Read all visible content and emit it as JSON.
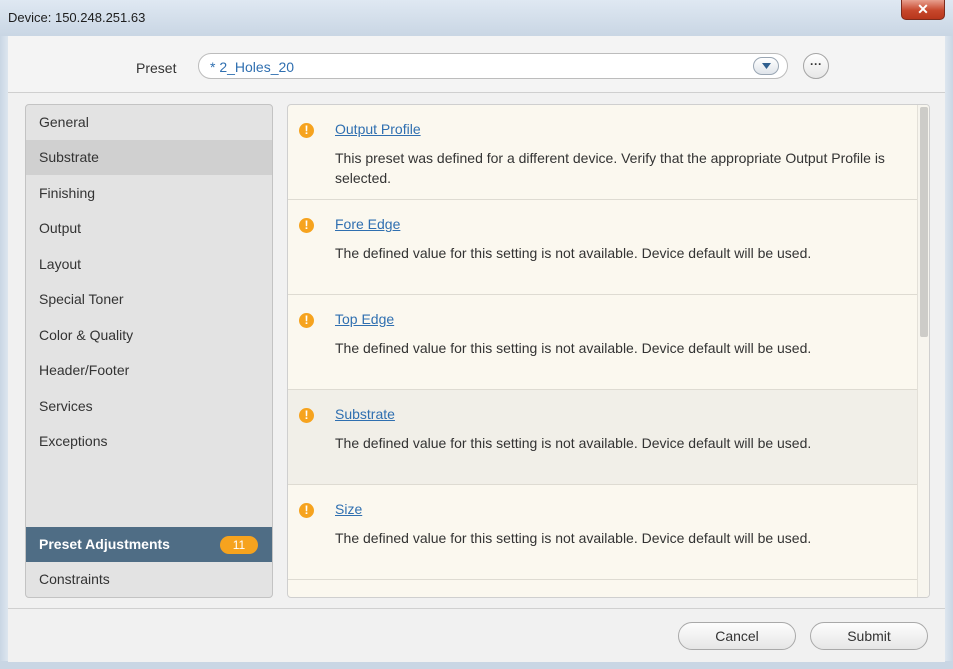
{
  "window": {
    "title": "Device: 150.248.251.63",
    "close_glyph": "✕"
  },
  "preset": {
    "label": "Preset",
    "value": "* 2_Holes_20",
    "more_glyph": "···"
  },
  "sidebar": {
    "items": [
      {
        "label": "General"
      },
      {
        "label": "Substrate"
      },
      {
        "label": "Finishing"
      },
      {
        "label": "Output"
      },
      {
        "label": "Layout"
      },
      {
        "label": "Special Toner"
      },
      {
        "label": "Color & Quality"
      },
      {
        "label": "Header/Footer"
      },
      {
        "label": "Services"
      },
      {
        "label": "Exceptions"
      }
    ],
    "active": {
      "label": "Preset Adjustments",
      "count": "11"
    },
    "bottom": {
      "label": "Constraints"
    }
  },
  "issues": [
    {
      "title": "Output Profile",
      "message": "This preset was defined for a different device. Verify that the appropriate Output Profile is selected."
    },
    {
      "title": "Fore Edge",
      "message": "The defined value for this setting is not available. Device default will be used."
    },
    {
      "title": "Top Edge",
      "message": "The defined value for this setting is not available. Device default will be used."
    },
    {
      "title": "Substrate",
      "message": "The defined value for this setting is not available. Device default will be used."
    },
    {
      "title": "Size",
      "message": "The defined value for this setting is not available. Device default will be used."
    }
  ],
  "icons": {
    "warning": "!"
  },
  "footer": {
    "cancel_label": "Cancel",
    "submit_label": "Submit"
  },
  "colors": {
    "accent": "#2f6fb0",
    "warning": "#f6a31e",
    "active_nav": "#4f6d85"
  }
}
